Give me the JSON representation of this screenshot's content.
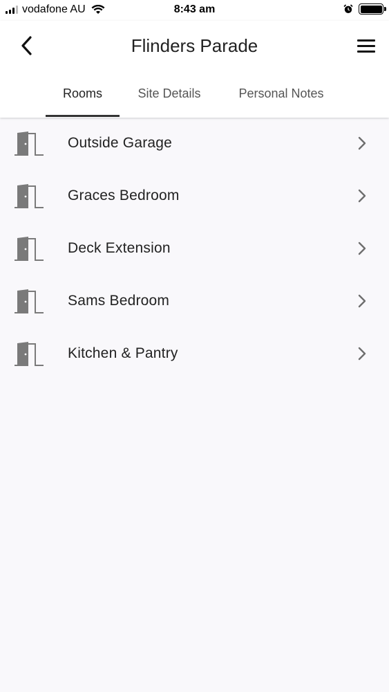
{
  "status_bar": {
    "carrier": "vodafone AU",
    "time": "8:43 am"
  },
  "header": {
    "title": "Flinders Parade",
    "back_icon": "chevron-left-icon",
    "menu_icon": "hamburger-menu-icon"
  },
  "tabs": [
    {
      "label": "Rooms",
      "active": true
    },
    {
      "label": "Site Details",
      "active": false
    },
    {
      "label": "Personal Notes",
      "active": false
    }
  ],
  "rooms": [
    {
      "label": "Outside Garage",
      "icon": "door-icon"
    },
    {
      "label": "Graces Bedroom",
      "icon": "door-icon"
    },
    {
      "label": "Deck Extension",
      "icon": "door-icon"
    },
    {
      "label": "Sams Bedroom",
      "icon": "door-icon"
    },
    {
      "label": "Kitchen & Pantry",
      "icon": "door-icon"
    }
  ],
  "colors": {
    "background": "#f9f8fb",
    "header": "#ffffff",
    "icon_gray": "#7a7a7a",
    "tab_indicator": "#333333"
  }
}
